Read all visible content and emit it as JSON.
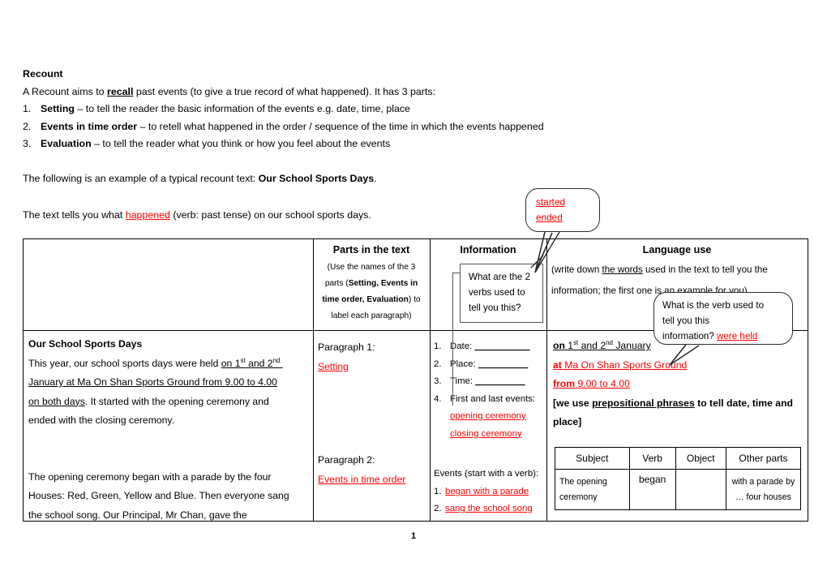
{
  "document": {
    "heading": "Recount",
    "intro_line": {
      "a": "A Recount aims to ",
      "b": "recall",
      "c": " past events (to give a true record of what happened). It has 3 parts:"
    },
    "parts_list": [
      {
        "num": "1.",
        "bold": "Setting",
        "rest": " – to tell the reader the basic information of the events e.g. date, time, place"
      },
      {
        "num": "2.",
        "bold": "Events in time order",
        "rest": " – to retell what happened in the order / sequence of the time in which the events happened"
      },
      {
        "num": "3.",
        "bold": "Evaluation",
        "rest": " – to tell the reader what you think or how you feel about the events"
      }
    ],
    "example_line": {
      "a": "The following is an example of a typical recount text: ",
      "b": "Our School Sports Days",
      "c": "."
    },
    "tells_line": {
      "a": "The text tells you what ",
      "b": "happened",
      "c": " (verb: past tense) on our school sports days."
    },
    "page_number": "1"
  },
  "callouts": {
    "verbs_bubble": {
      "line1": "started",
      "line2": "ended"
    },
    "two_verbs_box": {
      "line1": "What are the 2",
      "line2": "verbs used to",
      "line3": "tell you this?"
    },
    "verb_bubble": {
      "line1": "What is the verb used to",
      "line2": "tell you this",
      "line3_a": "information? ",
      "line3_b": "were held"
    }
  },
  "table": {
    "headers": {
      "col1": "",
      "col2": {
        "title": "Parts in the text",
        "sub_l1": "(Use the names of the 3",
        "sub_l2_a": "parts (",
        "sub_l2_b": "Setting, Events in",
        "sub_l3_a": "time order, Evaluation",
        "sub_l3_b": ") to",
        "sub_l4": "label each paragraph)"
      },
      "col3": {
        "title": "Information"
      },
      "col4": {
        "title": "Language use",
        "sub_l1_a": "(write down ",
        "sub_l1_b": "the words",
        "sub_l1_c": " used in the text to tell you the",
        "sub_l2": "information; the first one is an example for you)"
      }
    },
    "row1": {
      "text_title": "Our School Sports Days",
      "text_l1_a": "This year, our school sports days were held ",
      "text_l1_b": "on 1",
      "text_l1_sup1": "st",
      "text_l1_c": " and 2",
      "text_l1_sup2": "nd",
      "text_l2_a": "January",
      "text_l2_b": " at Ma On Shan Sports Ground",
      "text_l2_c": " from 9.00 to 4.00",
      "text_l3_a": "on both days",
      "text_l3_b": ". It started with the opening ceremony and",
      "text_l4": "ended with the closing ceremony.",
      "parts_label": "Paragraph 1:",
      "parts_value": "Setting",
      "info_items": [
        {
          "n": "1.",
          "label": "Date: ",
          "blank": "__________"
        },
        {
          "n": "2.",
          "label": "Place: ",
          "blank": "_________"
        },
        {
          "n": "3.",
          "label": "Time: ",
          "blank": "_________"
        },
        {
          "n": "4.",
          "label": "First and last events:",
          "blank": ""
        }
      ],
      "info_sub1": "opening ceremony ",
      "info_sub2": "closing ceremony",
      "lang_l1_a": "on",
      "lang_l1_b": " 1",
      "lang_l1_sup1": "st",
      "lang_l1_c": " and 2",
      "lang_l1_sup2": "nd",
      "lang_l1_d": " January",
      "lang_l2_a": "at",
      "lang_l2_b": " Ma On Shan Sports Ground",
      "lang_l3_a": "from",
      "lang_l3_b": " 9.00 to 4.00 ",
      "lang_l4_a": "[we use ",
      "lang_l4_b": "prepositional phrases",
      "lang_l4_c": " to tell date, time and",
      "lang_l5": "place]"
    },
    "row2": {
      "text_l1": "The opening ceremony began with a parade by the four",
      "text_l2": "Houses: Red, Green, Yellow and Blue. Then everyone sang",
      "text_l3": "the school song. Our Principal, Mr Chan, gave the",
      "parts_label": "Paragraph 2:",
      "parts_value": "Events in time order",
      "info_title": "Events (start with a verb):",
      "info_items": [
        {
          "n": "1.",
          "value": "began with a parade"
        },
        {
          "n": "2.",
          "value": "sang the school song"
        }
      ],
      "grammar_table": {
        "headers": [
          "Subject",
          "Verb",
          "Object",
          "Other parts"
        ],
        "rows": [
          {
            "subject_l1": "The opening",
            "subject_l2": "ceremony",
            "verb": "began",
            "object": "",
            "other_l1": "with a parade by",
            "other_l2": "… four houses"
          }
        ]
      }
    }
  },
  "colors": {
    "red": "#ff0000",
    "black": "#000000",
    "border": "#000000"
  }
}
